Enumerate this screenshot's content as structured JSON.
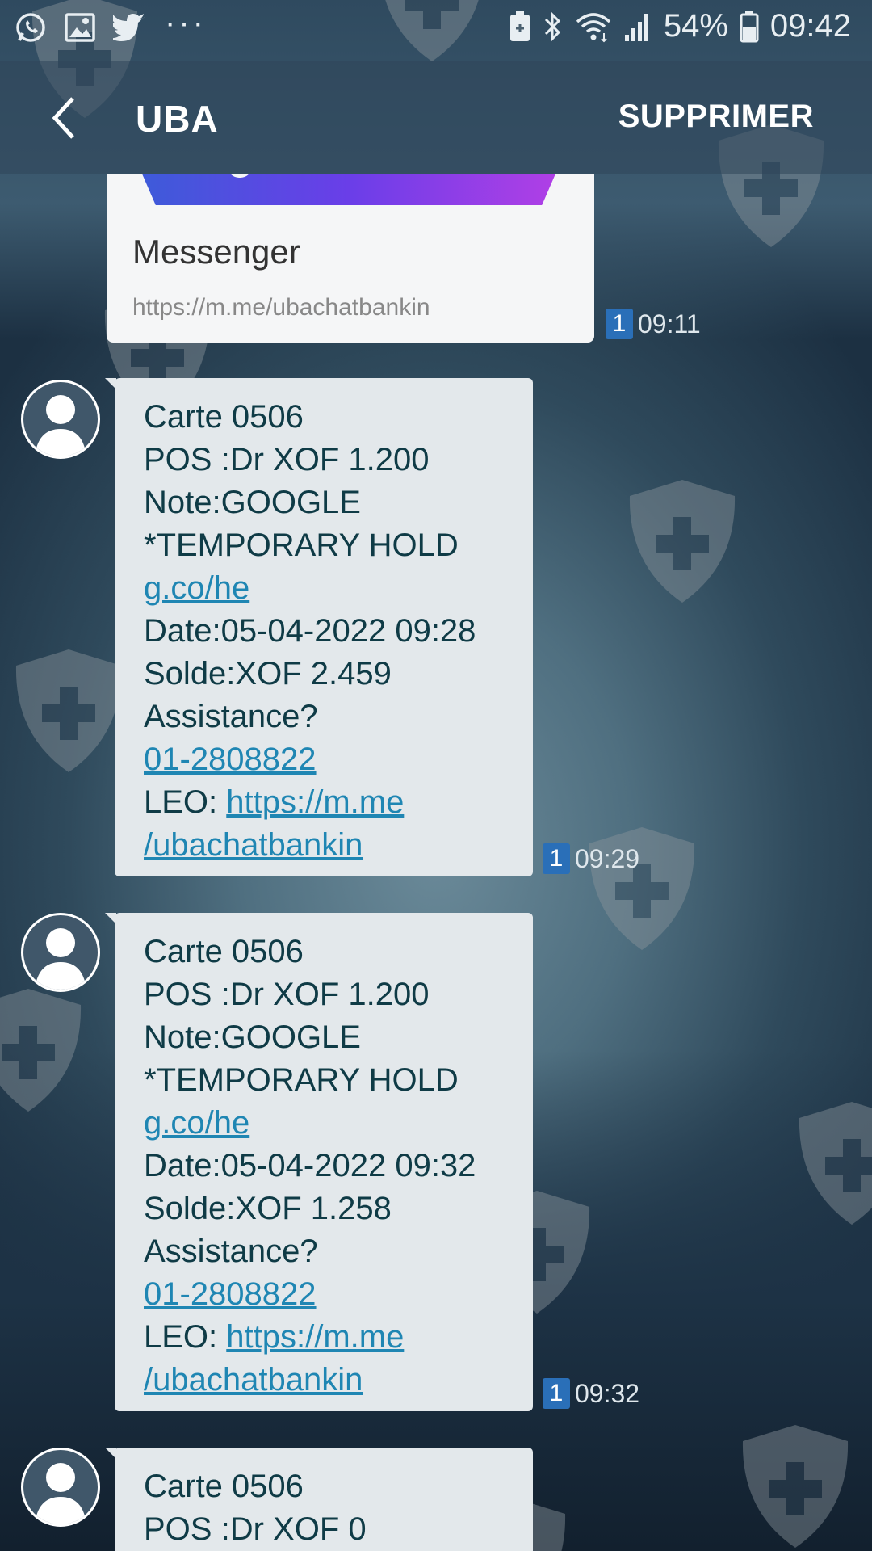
{
  "status_bar": {
    "battery": "54%",
    "time": "09:42",
    "left_icons": [
      "whatsapp-icon",
      "image-icon",
      "twitter-icon",
      "more-dots-icon"
    ],
    "right_icons": [
      "battery-saver-icon",
      "bluetooth-icon",
      "wifi-icon",
      "signal-icon",
      "battery-icon"
    ]
  },
  "header": {
    "title": "UBA",
    "delete_label": "SUPPRIMER"
  },
  "link_preview": {
    "name": "Messenger",
    "url": "https://m.me/ubachatbankin",
    "sim": "1",
    "time": "09:11"
  },
  "messages": [
    {
      "lines": [
        "Carte 0506",
        "POS :Dr  XOF 1.200",
        "Note:GOOGLE",
        "*TEMPORARY HOLD"
      ],
      "link1": "g.co/he",
      "lines2": [
        "Date:05-04-2022 09:28",
        "Solde:XOF 2.459",
        "Assistance?"
      ],
      "phone": "01-2808822",
      "leo_prefix": "LEO: ",
      "leo_link1": "https://m.me",
      "leo_link2": "/ubachatbankin",
      "sim": "1",
      "time": "09:29"
    },
    {
      "lines": [
        "Carte 0506",
        "POS :Dr  XOF 1.200",
        "Note:GOOGLE",
        "*TEMPORARY HOLD"
      ],
      "link1": "g.co/he",
      "lines2": [
        "Date:05-04-2022 09:32",
        "Solde:XOF 1.258",
        "Assistance?"
      ],
      "phone": "01-2808822",
      "leo_prefix": "LEO: ",
      "leo_link1": "https://m.me",
      "leo_link2": "/ubachatbankin",
      "sim": "1",
      "time": "09:32"
    },
    {
      "lines": [
        "Carte 0506",
        "POS :Dr  XOF 0"
      ]
    }
  ],
  "colors": {
    "link": "#1f86b3",
    "bubble": "#e3e8eb",
    "sim_badge": "#2a6fb8"
  }
}
